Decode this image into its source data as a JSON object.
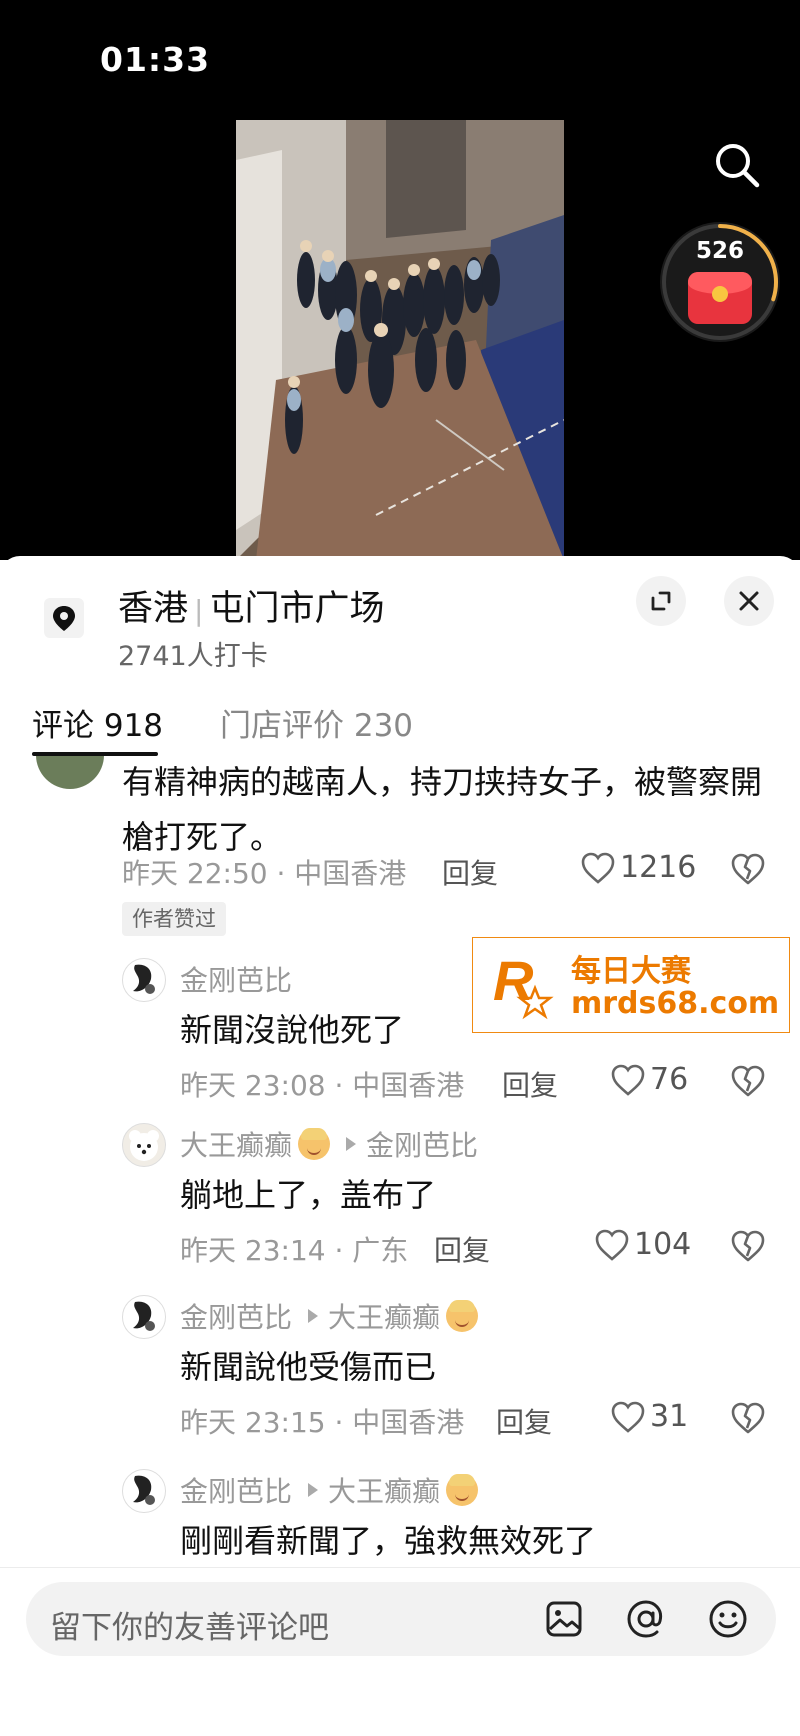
{
  "status_bar": {
    "time": "01:33"
  },
  "video_overlay": {
    "red_packet_count": "526",
    "red_packet_progress": 0.3,
    "brand_red": "#e8343e"
  },
  "location": {
    "name": "香港",
    "detail": "屯门市广场",
    "checkins": "2741人打卡"
  },
  "tabs": [
    {
      "label": "评论 918",
      "active": true
    },
    {
      "label": "门店评价 230",
      "active": false
    }
  ],
  "comment": {
    "text": "有精神病的越南人，持刀挟持女子，被警察開槍打死了。",
    "time_loc": "昨天 22:50 · 中国香港",
    "reply_label": "回复",
    "likes": "1216",
    "author_badge": "作者赞过"
  },
  "replies": [
    {
      "user": "金刚芭比",
      "reply_to": "",
      "text": "新聞沒說他死了",
      "time_loc": "昨天 23:08 · 中国香港",
      "reply_label": "回复",
      "likes": "76"
    },
    {
      "user": "大王癫癫",
      "reply_to": "金刚芭比",
      "text": "躺地上了，盖布了",
      "time_loc": "昨天 23:14 · 广东",
      "reply_label": "回复",
      "likes": "104"
    },
    {
      "user": "金刚芭比",
      "reply_to": "大王癫癫",
      "text": "新聞說他受傷而已",
      "time_loc": "昨天 23:15 · 中国香港",
      "reply_label": "回复",
      "likes": "31"
    },
    {
      "user": "金刚芭比",
      "reply_to": "大王癫癫",
      "text": "剛剛看新聞了，強救無效死了"
    }
  ],
  "watermark": {
    "line1": "每日大赛",
    "line2": "mrds68.com",
    "color": "#ec7a00"
  },
  "comment_input": {
    "placeholder": "留下你的友善评论吧"
  },
  "icons": [
    "search-icon",
    "red-packet-icon",
    "location-pin-icon",
    "expand-icon",
    "close-icon",
    "heart-icon",
    "broken-heart-icon",
    "image-icon",
    "at-icon",
    "emoji-icon"
  ]
}
